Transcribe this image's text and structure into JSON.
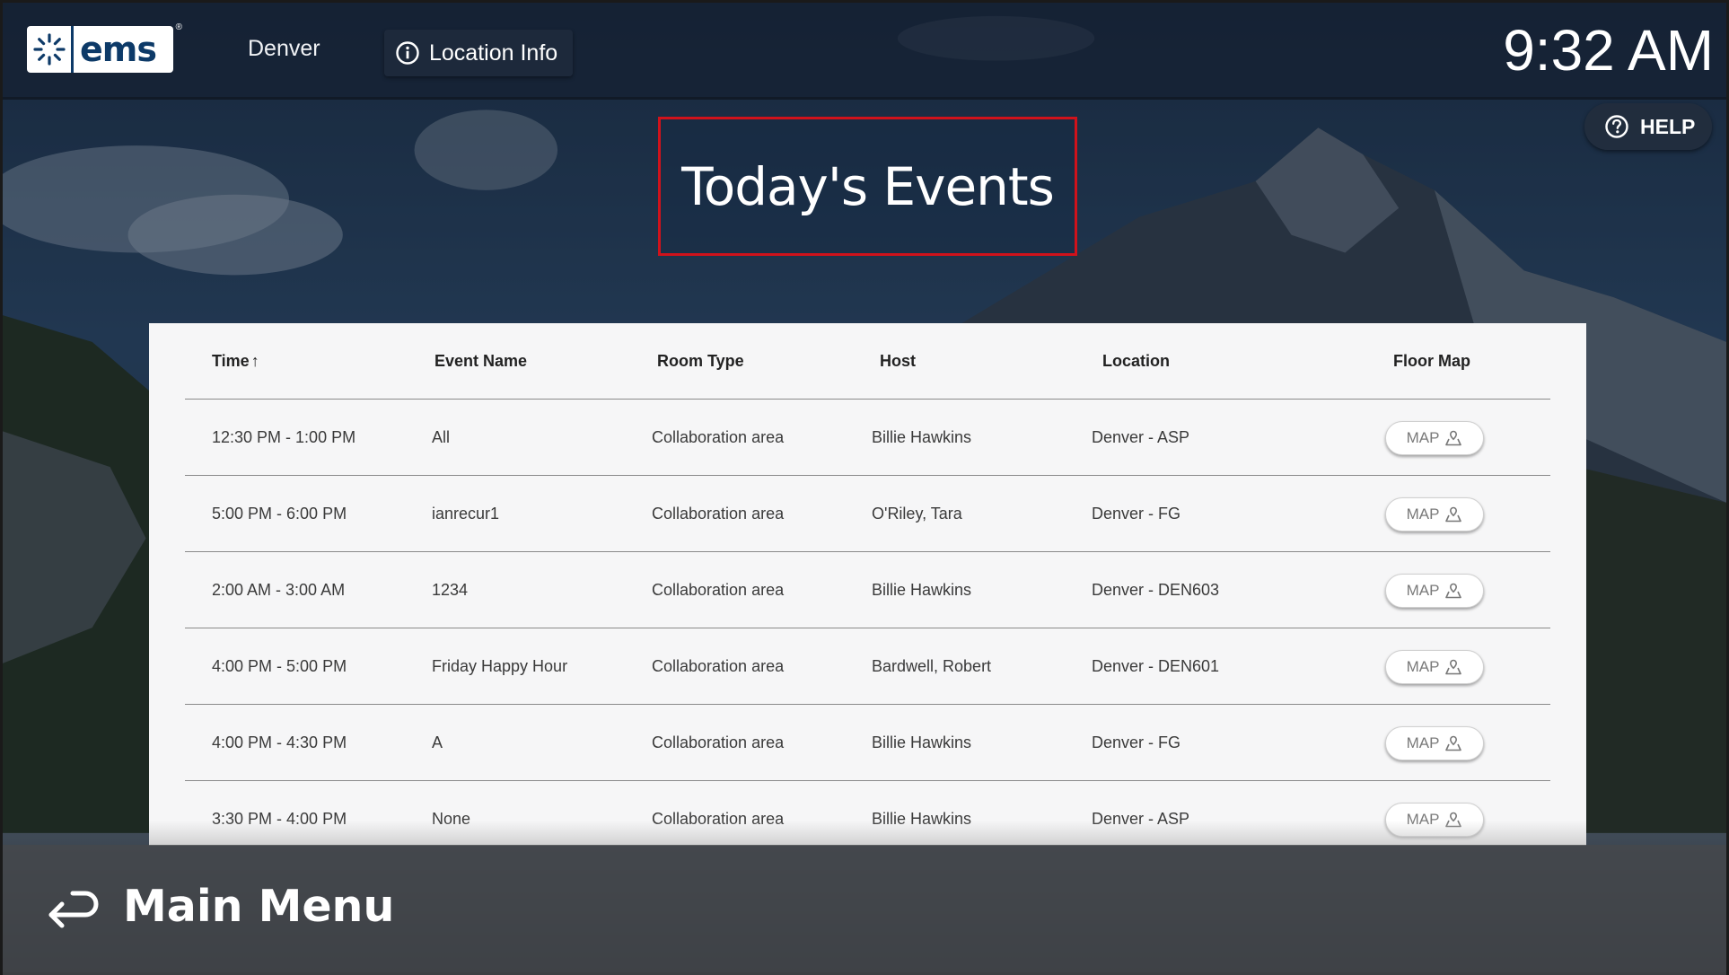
{
  "header": {
    "logo_text": "ems",
    "location_name": "Denver",
    "location_info_label": "Location Info",
    "clock": "9:32 AM",
    "help_label": "HELP"
  },
  "page": {
    "title": "Today's Events"
  },
  "table": {
    "columns": {
      "time": "Time",
      "sort_indicator": "↑",
      "event_name": "Event Name",
      "room_type": "Room Type",
      "host": "Host",
      "location": "Location",
      "floor_map": "Floor Map"
    },
    "map_button_label": "MAP",
    "rows": [
      {
        "time": "12:30 PM - 1:00 PM",
        "event_name": "All",
        "room_type": "Collaboration area",
        "host": "Billie Hawkins",
        "location": "Denver - ASP"
      },
      {
        "time": "5:00 PM - 6:00 PM",
        "event_name": "ianrecur1",
        "room_type": "Collaboration area",
        "host": "O'Riley, Tara",
        "location": "Denver - FG"
      },
      {
        "time": "2:00 AM - 3:00 AM",
        "event_name": "1234",
        "room_type": "Collaboration area",
        "host": "Billie Hawkins",
        "location": "Denver - DEN603"
      },
      {
        "time": "4:00 PM - 5:00 PM",
        "event_name": "Friday Happy Hour",
        "room_type": "Collaboration area",
        "host": "Bardwell, Robert",
        "location": "Denver - DEN601"
      },
      {
        "time": "4:00 PM - 4:30 PM",
        "event_name": "A",
        "room_type": "Collaboration area",
        "host": "Billie Hawkins",
        "location": "Denver - FG"
      },
      {
        "time": "3:30 PM - 4:00 PM",
        "event_name": "None",
        "room_type": "Collaboration area",
        "host": "Billie Hawkins",
        "location": "Denver - ASP"
      }
    ]
  },
  "footer": {
    "main_menu_label": "Main Menu"
  },
  "colors": {
    "highlight_border": "#d0121b",
    "logo_blue": "#0d3a68",
    "panel_bg": "#f6f6f7"
  },
  "icons": [
    "ems-logo-icon",
    "info-icon",
    "help-icon",
    "sort-arrow-icon",
    "map-icon",
    "return-arrow-icon"
  ]
}
